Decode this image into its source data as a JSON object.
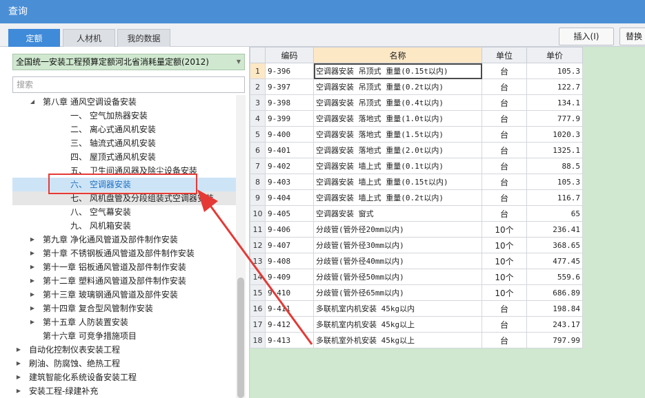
{
  "window": {
    "title": "查询"
  },
  "tabs": [
    {
      "label": "定额",
      "active": true
    },
    {
      "label": "人材机",
      "active": false
    },
    {
      "label": "我的数据",
      "active": false
    }
  ],
  "toolbar": {
    "insert_label": "插入(I)",
    "replace_label": "替换"
  },
  "left": {
    "dropdown_value": "全国统一安装工程预算定额河北省消耗量定额(2012)",
    "search_placeholder": "搜索",
    "tree": [
      {
        "label": "第八章 通风空调设备安装",
        "indent": 1,
        "caret": "open",
        "state": ""
      },
      {
        "label": "一、 空气加热器安装",
        "indent": 3,
        "caret": "",
        "state": ""
      },
      {
        "label": "二、 离心式通风机安装",
        "indent": 3,
        "caret": "",
        "state": ""
      },
      {
        "label": "三、 轴流式通风机安装",
        "indent": 3,
        "caret": "",
        "state": ""
      },
      {
        "label": "四、 屋顶式通风机安装",
        "indent": 3,
        "caret": "",
        "state": ""
      },
      {
        "label": "五、 卫生间通风器及除尘设备安装",
        "indent": 3,
        "caret": "",
        "state": ""
      },
      {
        "label": "六、 空调器安装",
        "indent": 3,
        "caret": "",
        "state": "sel"
      },
      {
        "label": "七、 风机盘管及分段组装式空调器安装",
        "indent": 3,
        "caret": "",
        "state": "hl"
      },
      {
        "label": "八、 空气幕安装",
        "indent": 3,
        "caret": "",
        "state": ""
      },
      {
        "label": "九、 风机箱安装",
        "indent": 3,
        "caret": "",
        "state": ""
      },
      {
        "label": "第九章 净化通风管道及部件制作安装",
        "indent": 1,
        "caret": "closed",
        "state": ""
      },
      {
        "label": "第十章 不锈钢板通风管道及部件制作安装",
        "indent": 1,
        "caret": "closed",
        "state": ""
      },
      {
        "label": "第十一章 铝板通风管道及部件制作安装",
        "indent": 1,
        "caret": "closed",
        "state": ""
      },
      {
        "label": "第十二章 塑料通风管道及部件制作安装",
        "indent": 1,
        "caret": "closed",
        "state": ""
      },
      {
        "label": "第十三章 玻璃钢通风管道及部件安装",
        "indent": 1,
        "caret": "closed",
        "state": ""
      },
      {
        "label": "第十四章 复合型风管制作安装",
        "indent": 1,
        "caret": "closed",
        "state": ""
      },
      {
        "label": "第十五章 人防装置安装",
        "indent": 1,
        "caret": "closed",
        "state": ""
      },
      {
        "label": "第十六章 可竞争措施项目",
        "indent": 1,
        "caret": "",
        "state": ""
      },
      {
        "label": "自动化控制仪表安装工程",
        "indent": 0,
        "caret": "closed",
        "state": ""
      },
      {
        "label": "刷油、防腐蚀、绝热工程",
        "indent": 0,
        "caret": "closed",
        "state": ""
      },
      {
        "label": "建筑智能化系统设备安装工程",
        "indent": 0,
        "caret": "closed",
        "state": ""
      },
      {
        "label": "安装工程-绿建补充",
        "indent": 0,
        "caret": "closed",
        "state": ""
      }
    ]
  },
  "grid": {
    "headers": [
      "",
      "编码",
      "名称",
      "单位",
      "单价"
    ],
    "rows": [
      {
        "no": "1",
        "code": "9-396",
        "name": "空调器安装 吊顶式 重量(0.15t以内)",
        "unit": "台",
        "price": "105.3",
        "selected": true
      },
      {
        "no": "2",
        "code": "9-397",
        "name": "空调器安装 吊顶式 重量(0.2t以内)",
        "unit": "台",
        "price": "122.7"
      },
      {
        "no": "3",
        "code": "9-398",
        "name": "空调器安装 吊顶式 重量(0.4t以内)",
        "unit": "台",
        "price": "134.1"
      },
      {
        "no": "4",
        "code": "9-399",
        "name": "空调器安装 落地式 重量(1.0t以内)",
        "unit": "台",
        "price": "777.9"
      },
      {
        "no": "5",
        "code": "9-400",
        "name": "空调器安装 落地式 重量(1.5t以内)",
        "unit": "台",
        "price": "1020.3"
      },
      {
        "no": "6",
        "code": "9-401",
        "name": "空调器安装 落地式 重量(2.0t以内)",
        "unit": "台",
        "price": "1325.1"
      },
      {
        "no": "7",
        "code": "9-402",
        "name": "空调器安装 墙上式 重量(0.1t以内)",
        "unit": "台",
        "price": "88.5"
      },
      {
        "no": "8",
        "code": "9-403",
        "name": "空调器安装 墙上式 重量(0.15t以内)",
        "unit": "台",
        "price": "105.3"
      },
      {
        "no": "9",
        "code": "9-404",
        "name": "空调器安装 墙上式 重量(0.2t以内)",
        "unit": "台",
        "price": "116.7"
      },
      {
        "no": "10",
        "code": "9-405",
        "name": "空调器安装 窗式",
        "unit": "台",
        "price": "65"
      },
      {
        "no": "11",
        "code": "9-406",
        "name": "分歧管(管外径20mm以内)",
        "unit": "10个",
        "price": "236.41"
      },
      {
        "no": "12",
        "code": "9-407",
        "name": "分歧管(管外径30mm以内)",
        "unit": "10个",
        "price": "368.65"
      },
      {
        "no": "13",
        "code": "9-408",
        "name": "分歧管(管外径40mm以内)",
        "unit": "10个",
        "price": "477.45"
      },
      {
        "no": "14",
        "code": "9-409",
        "name": "分歧管(管外径50mm以内)",
        "unit": "10个",
        "price": "559.6"
      },
      {
        "no": "15",
        "code": "9-410",
        "name": "分歧管(管外径65mm以内)",
        "unit": "10个",
        "price": "686.89"
      },
      {
        "no": "16",
        "code": "9-411",
        "name": "多联机室内机安装 45kg以内",
        "unit": "台",
        "price": "198.84"
      },
      {
        "no": "17",
        "code": "9-412",
        "name": "多联机室内机安装 45kg以上",
        "unit": "台",
        "price": "243.17"
      },
      {
        "no": "18",
        "code": "9-413",
        "name": "多联机室外机安装 45kg以上",
        "unit": "台",
        "price": "797.99"
      }
    ]
  },
  "colors": {
    "accent": "#3f8ad9",
    "grid_bg": "#cfe8cf",
    "annotation": "#e53935",
    "header_highlight": "#fde8c6"
  }
}
